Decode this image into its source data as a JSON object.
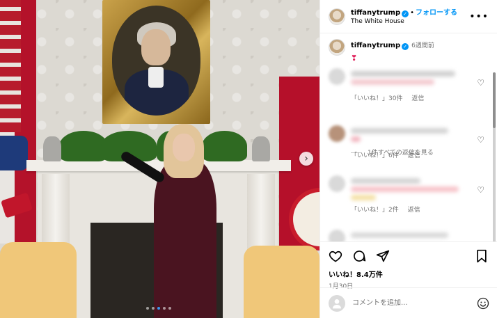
{
  "header": {
    "username": "tiffanytrump",
    "separator": "•",
    "follow_label": "フォローする",
    "location": "The White House",
    "more_icon": "more-horizontal-icon"
  },
  "caption": {
    "username": "tiffanytrump",
    "time": "6週間前",
    "text": "❣"
  },
  "comments": [
    {
      "likes_label": "「いいね！」30件",
      "reply_label": "返信",
      "replies_label": "1件すべての返信を見る"
    },
    {
      "likes_label": "「いいね！」6件",
      "reply_label": "返信"
    },
    {
      "likes_label": "「いいね！」2件",
      "reply_label": "返信"
    }
  ],
  "actions": {
    "likes": "いいね！8.4万件",
    "date": "1月30日"
  },
  "composer": {
    "placeholder": "コメントを追加..."
  },
  "media": {
    "carousel_total": 5,
    "carousel_active": 3
  },
  "colors": {
    "accent": "#0095f6",
    "dot_active": "#3897f0",
    "heart": "#e0245e"
  }
}
